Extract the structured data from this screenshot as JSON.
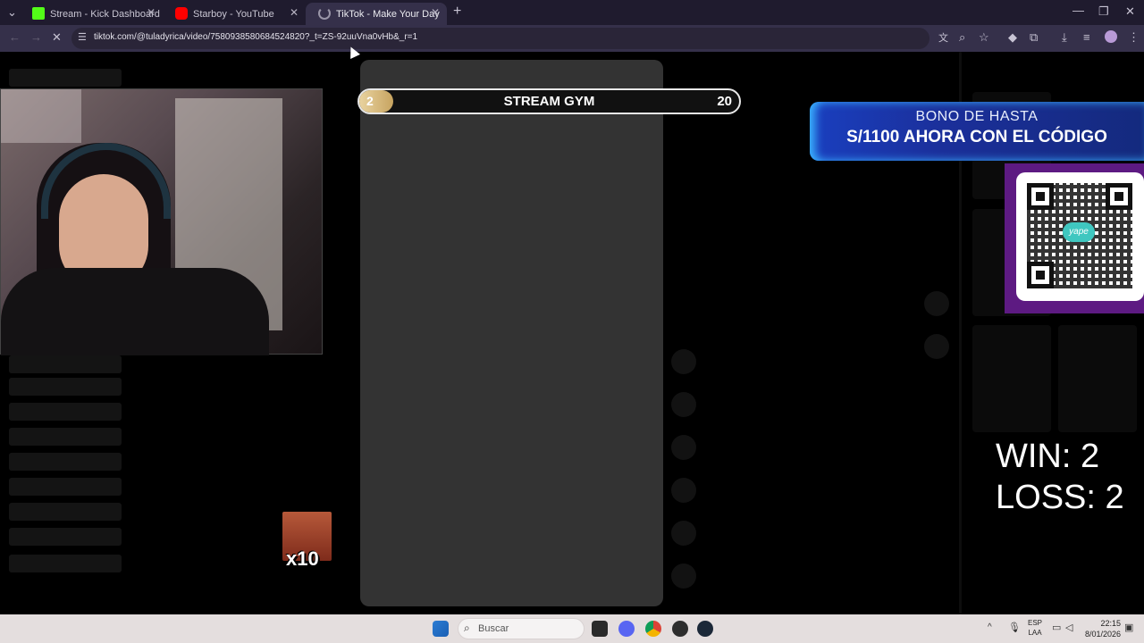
{
  "browser": {
    "tabs": [
      {
        "label": "Stream - Kick Dashboard",
        "favicon": "kick-icon",
        "color": "#53fc18"
      },
      {
        "label": "Starboy - YouTube",
        "favicon": "youtube-icon",
        "color": "#ff0000"
      },
      {
        "label": "TikTok - Make Your Day",
        "favicon": "loading-icon",
        "active": true
      }
    ],
    "url": "tiktok.com/@tuladyrica/video/7580938580684524820?_t=ZS-92uuVna0vHb&_r=1"
  },
  "overlay": {
    "gym_badge": "2",
    "gym_title": "STREAM GYM",
    "gym_count": "20",
    "bono_line1": "BONO DE HASTA",
    "bono_line2": "S/1100 AHORA CON EL CÓDIGO",
    "qr_brand": "yape",
    "win": "WIN: 2",
    "loss": "LOSS: 2",
    "emote_multiplier": "x10"
  },
  "taskbar": {
    "search_placeholder": "Buscar",
    "lang_line1": "ESP",
    "lang_line2": "LAA",
    "time": "22:15",
    "date": "8/01/2026"
  }
}
